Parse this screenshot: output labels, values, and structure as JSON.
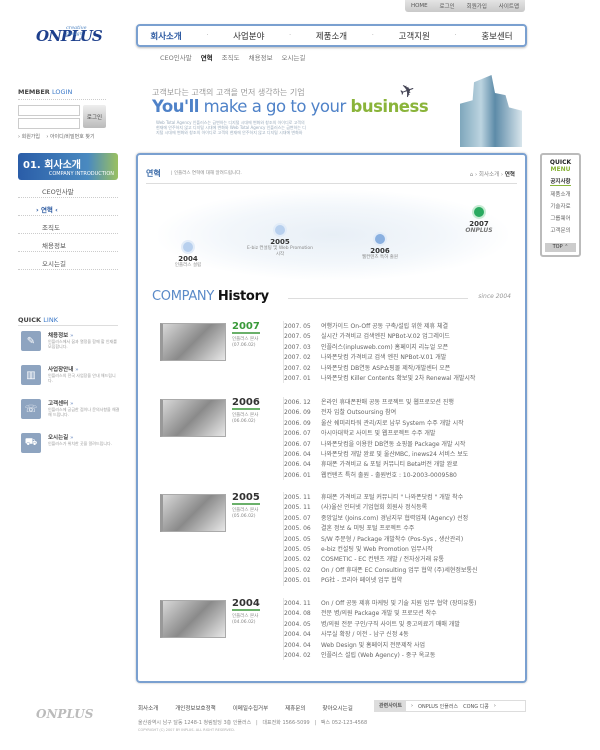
{
  "util": [
    "HOME",
    "로그인",
    "회원가입",
    "사이트맵"
  ],
  "logo": {
    "text": "ONPLUS",
    "tag": "creative design"
  },
  "nav": [
    "회사소개",
    "사업분야",
    "제품소개",
    "고객지원",
    "홍보센터"
  ],
  "subnav": [
    "CEO인사말",
    "연혁",
    "조직도",
    "채용정보",
    "오시는길"
  ],
  "login": {
    "title_a": "MEMBER",
    "title_b": "LOGIN",
    "button": "로그인",
    "join": "› 회원가입",
    "find": "› 아이디/비밀번호 찾기"
  },
  "banner": {
    "ko": "고객보다는 고객의 고객을 먼저 생각하는 기업",
    "en_a": "You'll",
    "en_b": "make a go to your",
    "en_c": "business",
    "desc": "Web Total Agency 인플러스는 급변하는 디지털 시대에 변화와 창조의 아이디로 고객의 현재에 안주하지 않고 디지털 시대에 변화와 Web Total Agency 인플러스는 급변하는 디지털 시대에 변화와 창조의 아이디로 고객의 현재에 안주하지 않고 디지털 시대에 변화와"
  },
  "lmenu": {
    "title": "01. 회사소개",
    "sub": "COMPANY INTRODUCTION",
    "items": [
      "CEO인사말",
      "› 연혁 ‹",
      "조직도",
      "채용정보",
      "오시는길"
    ]
  },
  "quicklink": {
    "title_a": "QUICK",
    "title_b": "LINK",
    "items": [
      {
        "name": "채용정보",
        "icon": "briefcase-icon",
        "desc": "인플러스에서 꿈과 열정을 함께 할 인재를 모집합니다."
      },
      {
        "name": "사업장안내",
        "icon": "building-icon",
        "desc": "인플러스의 전국 사업장을 안내 해드립니다."
      },
      {
        "name": "고객센터",
        "icon": "customer-icon",
        "desc": "인플러스에 궁금한 점이나 문의사항을 해결해 드립니다."
      },
      {
        "name": "오시는길",
        "icon": "car-icon",
        "desc": "인플러스가 위치한 곳을 알려드립니다."
      }
    ]
  },
  "page": {
    "title": "연혁",
    "desc": "| 인플러스 연혁에 대해 알려드립니다.",
    "crumb": [
      "회사소개",
      "연혁"
    ]
  },
  "milestones": [
    {
      "year": "2004",
      "desc": "인플러스 설립"
    },
    {
      "year": "2005",
      "desc": "E-biz 컨설팅 및 Web Promotion 시작"
    },
    {
      "year": "2006",
      "desc": "웹컨텐츠 특허 출원"
    },
    {
      "year": "2007",
      "desc": "ONPLUS"
    }
  ],
  "history_title": {
    "a": "COMPANY",
    "b": "History",
    "since": "since 2004"
  },
  "history": [
    {
      "year": "2007",
      "branch": "인플러스 본사",
      "date": "(07.06.02)",
      "rows": [
        [
          "2007. 05",
          "여행가이드 On-Off 공동 구축/설립 위한 제휴 체결"
        ],
        [
          "2007. 05",
          "실시간 가격비교 검색엔진 NPBot-V.02 업그레이드"
        ],
        [
          "2007. 03",
          "인플러스(inplusweb.com) 홈페이지 리뉴얼 오픈"
        ],
        [
          "2007. 02",
          "나와폰닷컴 가격비교 검색 엔진 NPBot-V.01 개발"
        ],
        [
          "2007. 02",
          "나와폰닷컴 DB연동 ASP쇼핑몰 제작/개발센터 오픈"
        ],
        [
          "2007. 01",
          "나와폰닷컴 Killer Contents 확보및 2차 Renewal 개발시작"
        ]
      ]
    },
    {
      "year": "2006",
      "branch": "인플러스 본사",
      "date": "(06.06.02)",
      "rows": [
        [
          "2006. 12",
          "온라인 휴대폰판매 공동 프로젝트 및 웹프로모션 진행"
        ],
        [
          "2006. 09",
          "전자 입찰 Outsoursing 참여"
        ],
        [
          "2006. 09",
          "울산 쉐미리타워 관리/지로 납부 System 수주 개발 시작"
        ],
        [
          "2006. 07",
          "아시아대학교 사이트 및 웹프로젝트 수주 개발"
        ],
        [
          "2006. 07",
          "나와폰닷컴을 이용한 DB연동 쇼핑몰 Package 개발 시작"
        ],
        [
          "2006. 04",
          "나와폰닷컴 개발 완료 및 울산MBC, inews24 서비스 보도"
        ],
        [
          "2006. 04",
          "휴대폰 가격비교 & 포털 커뮤니티 Beta버전 개발 완료"
        ],
        [
          "2006. 01",
          "웹컨텐츠 특허 출원 - 출원번호 : 10-2003-0009580"
        ]
      ]
    },
    {
      "year": "2005",
      "branch": "인플러스 본사",
      "date": "(05.06.02)",
      "rows": [
        [
          "2005. 11",
          "휴대폰 가격비교 포털 커뮤니티 \" 나와폰닷컴 \" 개발 착수"
        ],
        [
          "2005. 11",
          "(사)울산 인터넷 기업협회 회원사 정식등록"
        ],
        [
          "2005. 07",
          "중앙일보 (Joins.com) 경남지부 협력업체 (Agency) 선정"
        ],
        [
          "2005. 06",
          "결혼 정보 & 미팅 포털 프로젝트 수주"
        ],
        [
          "2005. 05",
          "S/W 주문형 / Package 개발착수 (Pos-Sys , 생산관리)"
        ],
        [
          "2005. 05",
          "e-biz 컨설팅 및 Web Promotion 업무시작"
        ],
        [
          "2005. 02",
          "COSMETIC - EC 컨텐츠 개발 / 전자상거래 유통"
        ],
        [
          "2005. 02",
          "On / Off 휴대폰 EC Consulting 업무 협약 (주)세현정보통신"
        ],
        [
          "2005. 01",
          "PG社 - 코리아 페이넷 업무 협약"
        ]
      ]
    },
    {
      "year": "2004",
      "branch": "인플러스 본사",
      "date": "(04.06.02)",
      "rows": [
        [
          "2004. 11",
          "On / Off 공동 제휴 마케팅 및 기술 지원 업무 협약 (장미유통)"
        ],
        [
          "2004. 08",
          "전문 병/의원 Package 개발 및 프로모션 착수"
        ],
        [
          "2004. 05",
          "병/의원 전문 구인/구직 사이트 및 중고의료기 매매 개발"
        ],
        [
          "2004. 04",
          "사무실 확장 / 이전 - 남구 신정 4동"
        ],
        [
          "2004. 04",
          "Web Design 및 홈페이지 전문제작 사업"
        ],
        [
          "2004. 02",
          "인플러스 설립 (Web Agency) - 중구 옥교동"
        ]
      ]
    }
  ],
  "quickmenu": {
    "a": "QUICK",
    "b": "MENU",
    "items": [
      "공지사항",
      "제품소개",
      "기술자료",
      "그룹웨어",
      "고객문의"
    ],
    "top": "TOP ⌃"
  },
  "footer": {
    "links": [
      "회사소개",
      "개인정보보호정책",
      "이메일수집거부",
      "제휴문의",
      "찾아오시는길"
    ],
    "address": "울산광역시 남구 달동 1248-1 청림빌딩 3층 인플러스   |   대표전화 1566-5099   |   팩스 052-123-4568",
    "copy": "COPYRIGHT (C) 2007 BY INPLUS. ALL RIGHT RESERVED.",
    "related": "관련사이트",
    "sites": [
      "ONPLUS 인플러스",
      "CONG 디콩"
    ]
  },
  "colors": {
    "accent": "#3a6aa8",
    "green": "#8ab43a",
    "border": "#7aa0d0"
  }
}
